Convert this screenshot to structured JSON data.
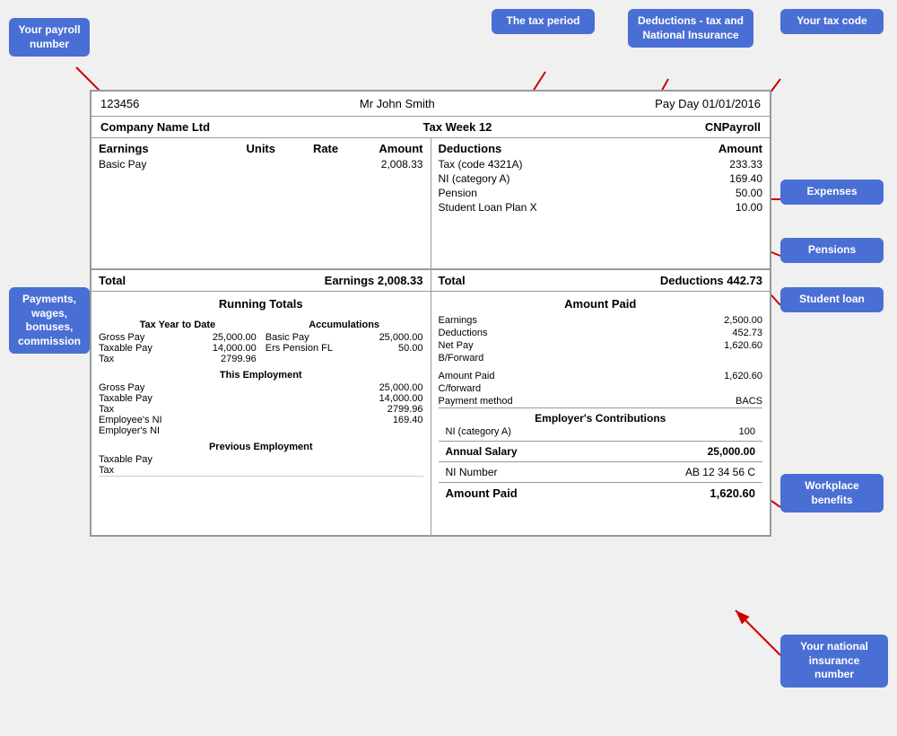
{
  "annotations": {
    "payroll_number": "Your\npayroll\nnumber",
    "tax_period": "The tax\nperiod",
    "deductions_tax_ni": "Deductions -\ntax and\nNational\nInsurance",
    "tax_code": "Your tax\ncode",
    "expenses": "Expenses",
    "pensions": "Pensions",
    "student_loan": "Student\nloan",
    "payments_wages": "Payments,\nwages,\nbonuses,\ncommission",
    "workplace_benefits": "Workplace\nbenefits",
    "national_insurance": "Your\nnational\ninsurance\nnumber"
  },
  "payslip": {
    "header": {
      "payroll_number": "123456",
      "employee_name": "Mr John Smith",
      "pay_date": "Pay Day 01/01/2016"
    },
    "company": {
      "name": "Company Name Ltd",
      "tax_week": "Tax Week 12",
      "system": "CNPayroll"
    },
    "earnings": {
      "columns": {
        "earnings": "Earnings",
        "units": "Units",
        "rate": "Rate",
        "amount": "Amount"
      },
      "items": [
        {
          "label": "Basic Pay",
          "units": "",
          "rate": "",
          "amount": "2,008.33"
        }
      ],
      "total_label": "Total",
      "total_earnings": "Earnings 2,008.33"
    },
    "deductions": {
      "columns": {
        "deductions": "Deductions",
        "amount": "Amount"
      },
      "items": [
        {
          "label": "Tax (code 4321A)",
          "amount": "233.33"
        },
        {
          "label": "NI (category A)",
          "amount": "169.40"
        },
        {
          "label": "Pension",
          "amount": "50.00"
        },
        {
          "label": "Student Loan Plan X",
          "amount": "10.00"
        }
      ],
      "total_label": "Total",
      "total_deductions": "Deductions 442.73"
    },
    "running_totals": {
      "title": "Running Totals",
      "tax_year_to_date": "Tax Year to Date",
      "accumulations": "Accumulations",
      "tax_ytd": [
        {
          "label": "Gross Pay",
          "value": "25,000.00"
        },
        {
          "label": "Taxable Pay",
          "value": "14,000.00"
        },
        {
          "label": "Tax",
          "value": "2799.96"
        }
      ],
      "accumulations_items": [
        {
          "label": "Basic Pay",
          "value": "25,000.00"
        },
        {
          "label": "Ers Pension FL",
          "value": "50.00"
        }
      ],
      "this_employment": "This Employment",
      "this_emp_items": [
        {
          "label": "Gross Pay",
          "value": "25,000.00"
        },
        {
          "label": "Taxable Pay",
          "value": "14,000.00"
        },
        {
          "label": "Tax",
          "value": "2799.96"
        },
        {
          "label": "Employee's NI",
          "value": "169.40"
        },
        {
          "label": "Employer's NI",
          "value": ""
        }
      ],
      "previous_employment": "Previous Employment",
      "prev_emp_items": [
        {
          "label": "Taxable Pay",
          "value": ""
        },
        {
          "label": "Tax",
          "value": ""
        }
      ]
    },
    "amount_paid": {
      "title": "Amount Paid",
      "items": [
        {
          "label": "Earnings",
          "value": "2,500.00"
        },
        {
          "label": "Deductions",
          "value": "452.73"
        },
        {
          "label": "Net Pay",
          "value": "1,620.60"
        },
        {
          "label": "B/Forward",
          "value": ""
        },
        {
          "label": "",
          "value": ""
        },
        {
          "label": "Amount Paid",
          "value": "1,620.60"
        },
        {
          "label": "C/forward",
          "value": ""
        },
        {
          "label": "Payment method",
          "value": "BACS"
        }
      ],
      "employer_contributions": {
        "title": "Employer's Contributions",
        "items": [
          {
            "label": "NI (category A)",
            "value": "100"
          }
        ]
      },
      "annual_salary": {
        "label": "Annual Salary",
        "value": "25,000.00"
      },
      "ni_number": {
        "label": "NI Number",
        "value": "AB 12 34 56 C"
      },
      "amount_paid_final": {
        "label": "Amount Paid",
        "value": "1,620.60"
      }
    }
  }
}
